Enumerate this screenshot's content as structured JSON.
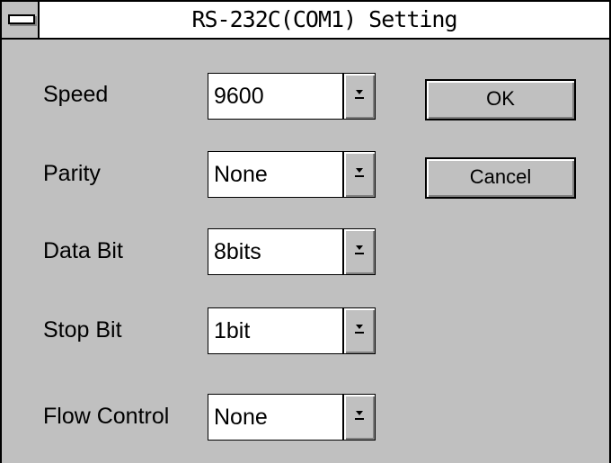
{
  "window": {
    "title": "RS-232C(COM1) Setting"
  },
  "fields": [
    {
      "label": "Speed",
      "value": "9600"
    },
    {
      "label": "Parity",
      "value": "None"
    },
    {
      "label": "Data Bit",
      "value": "8bits"
    },
    {
      "label": "Stop Bit",
      "value": "1bit"
    },
    {
      "label": "Flow Control",
      "value": "None"
    }
  ],
  "buttons": {
    "ok": "OK",
    "cancel": "Cancel"
  },
  "icons": {
    "system_menu": "system-menu-icon",
    "dropdown": "dropdown-arrow-icon"
  }
}
